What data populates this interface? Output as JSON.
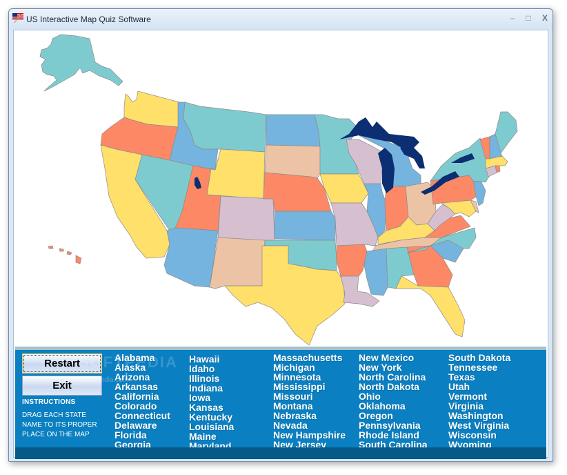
{
  "window": {
    "title": "US Interactive Map Quiz Software",
    "controls": [
      "minimize",
      "maximize",
      "close"
    ]
  },
  "buttons": {
    "restart": "Restart",
    "exit": "Exit"
  },
  "instructions": {
    "heading": "INSTRUCTIONS",
    "lines": [
      "DRAG EACH STATE",
      "NAME TO ITS PROPER",
      "PLACE ON THE MAP"
    ]
  },
  "watermark": {
    "brand": "SOFTPEDIA",
    "url": "www.softpedia.com"
  },
  "state_columns": [
    [
      "Alabama",
      "Alaska",
      "Arizona",
      "Arkansas",
      "California",
      "Colorado",
      "Connecticut",
      "Delaware",
      "Florida",
      "Georgia"
    ],
    [
      "Hawaii",
      "Idaho",
      "Illinois",
      "Indiana",
      "Iowa",
      "Kansas",
      "Kentucky",
      "Louisiana",
      "Maine",
      "Maryland"
    ],
    [
      "Massachusetts",
      "Michigan",
      "Minnesota",
      "Mississippi",
      "Missouri",
      "Montana",
      "Nebraska",
      "Nevada",
      "New Hampshire",
      "New Jersey"
    ],
    [
      "New Mexico",
      "New York",
      "North Carolina",
      "North Dakota",
      "Ohio",
      "Oklahoma",
      "Oregon",
      "Pennsylvania",
      "Rhode Island",
      "South Carolina"
    ],
    [
      "South Dakota",
      "Tennessee",
      "Texas",
      "Utah",
      "Vermont",
      "Virginia",
      "Washington",
      "West Virginia",
      "Wisconsin",
      "Wyoming"
    ]
  ],
  "map_colors": {
    "teal": "#7ecbcf",
    "blue": "#74b4df",
    "yellow": "#fee06a",
    "orange": "#fd8866",
    "mauve": "#d6bfcf",
    "tan": "#ecc4a5",
    "lake": "#0c2e72"
  },
  "map_states": [
    {
      "name": "Alaska",
      "color": "teal"
    },
    {
      "name": "Hawaii",
      "color": "orange"
    },
    {
      "name": "Washington",
      "color": "yellow"
    },
    {
      "name": "Oregon",
      "color": "orange"
    },
    {
      "name": "California",
      "color": "yellow"
    },
    {
      "name": "Idaho",
      "color": "blue"
    },
    {
      "name": "Nevada",
      "color": "teal"
    },
    {
      "name": "Montana",
      "color": "teal"
    },
    {
      "name": "Wyoming",
      "color": "yellow"
    },
    {
      "name": "Utah",
      "color": "orange"
    },
    {
      "name": "Arizona",
      "color": "blue"
    },
    {
      "name": "Colorado",
      "color": "mauve"
    },
    {
      "name": "New Mexico",
      "color": "tan"
    },
    {
      "name": "North Dakota",
      "color": "blue"
    },
    {
      "name": "South Dakota",
      "color": "tan"
    },
    {
      "name": "Nebraska",
      "color": "orange"
    },
    {
      "name": "Kansas",
      "color": "blue"
    },
    {
      "name": "Oklahoma",
      "color": "teal"
    },
    {
      "name": "Texas",
      "color": "yellow"
    },
    {
      "name": "Minnesota",
      "color": "teal"
    },
    {
      "name": "Iowa",
      "color": "yellow"
    },
    {
      "name": "Missouri",
      "color": "mauve"
    },
    {
      "name": "Arkansas",
      "color": "orange"
    },
    {
      "name": "Louisiana",
      "color": "mauve"
    },
    {
      "name": "Wisconsin",
      "color": "mauve"
    },
    {
      "name": "Illinois",
      "color": "blue"
    },
    {
      "name": "Michigan",
      "color": "blue"
    },
    {
      "name": "Indiana",
      "color": "orange"
    },
    {
      "name": "Ohio",
      "color": "tan"
    },
    {
      "name": "Kentucky",
      "color": "yellow"
    },
    {
      "name": "Tennessee",
      "color": "tan"
    },
    {
      "name": "Mississippi",
      "color": "blue"
    },
    {
      "name": "Alabama",
      "color": "teal"
    },
    {
      "name": "Georgia",
      "color": "orange"
    },
    {
      "name": "Florida",
      "color": "yellow"
    },
    {
      "name": "South Carolina",
      "color": "blue"
    },
    {
      "name": "North Carolina",
      "color": "teal"
    },
    {
      "name": "Virginia",
      "color": "orange"
    },
    {
      "name": "West Virginia",
      "color": "mauve"
    },
    {
      "name": "Maryland",
      "color": "yellow"
    },
    {
      "name": "Delaware",
      "color": "tan"
    },
    {
      "name": "Pennsylvania",
      "color": "orange"
    },
    {
      "name": "New Jersey",
      "color": "blue"
    },
    {
      "name": "New York",
      "color": "teal"
    },
    {
      "name": "Connecticut",
      "color": "mauve"
    },
    {
      "name": "Rhode Island",
      "color": "orange"
    },
    {
      "name": "Massachusetts",
      "color": "yellow"
    },
    {
      "name": "Vermont",
      "color": "orange"
    },
    {
      "name": "New Hampshire",
      "color": "blue"
    },
    {
      "name": "Maine",
      "color": "teal"
    }
  ]
}
